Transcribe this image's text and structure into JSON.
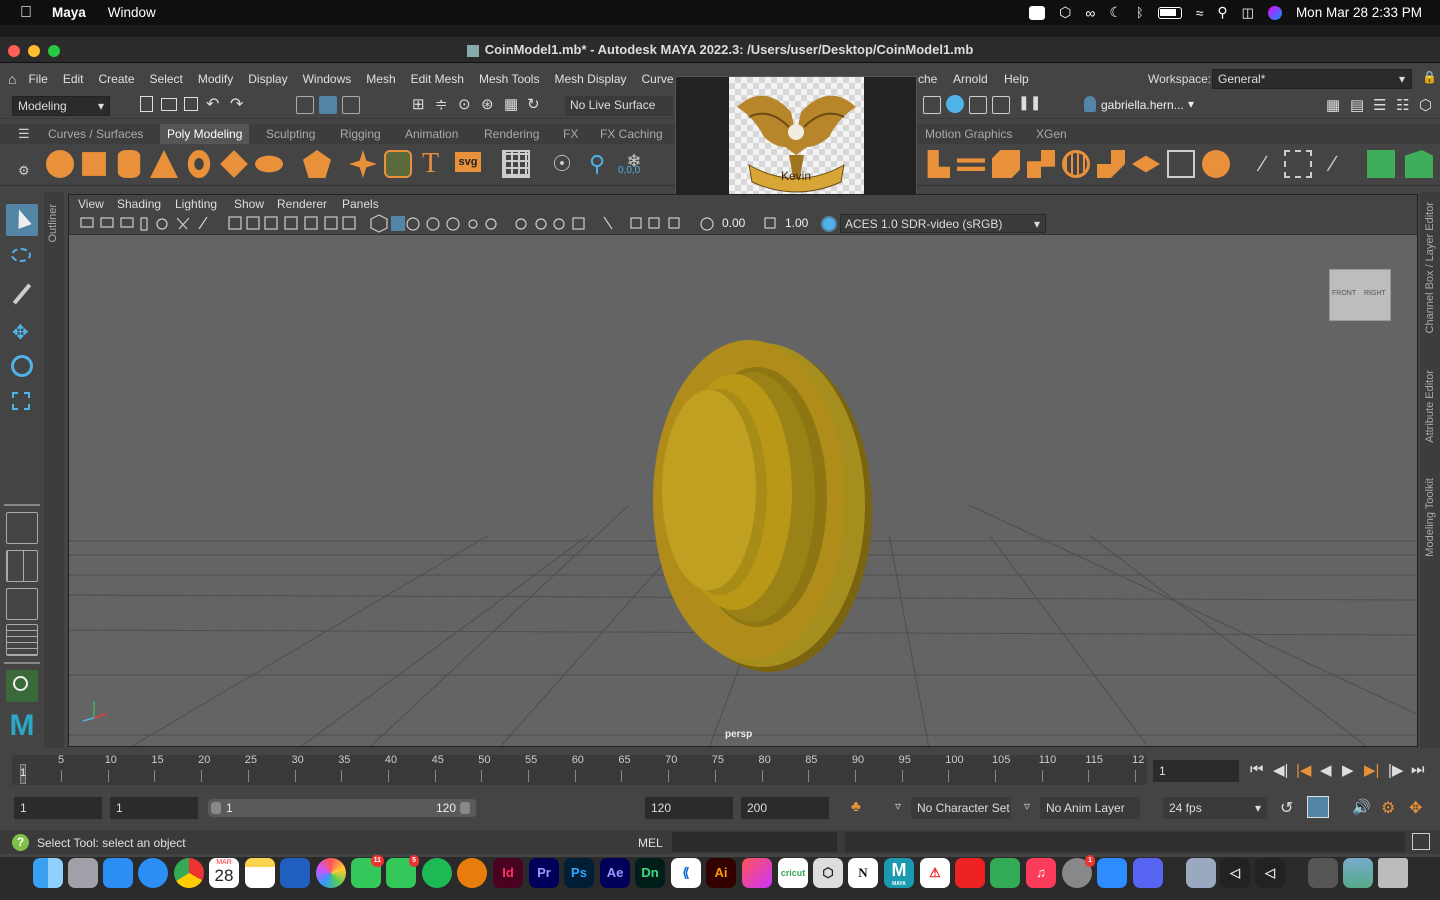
{
  "mac_menubar": {
    "app_name": "Maya",
    "menu_window": "Window",
    "datetime": "Mon Mar 28  2:33 PM"
  },
  "window": {
    "title": "CoinModel1.mb* - Autodesk MAYA 2022.3: /Users/user/Desktop/CoinModel1.mb"
  },
  "menus": [
    "File",
    "Edit",
    "Create",
    "Select",
    "Modify",
    "Display",
    "Windows",
    "Mesh",
    "Edit Mesh",
    "Mesh Tools",
    "Mesh Display",
    "Curve",
    "Arnold",
    "Help"
  ],
  "menu_partial": "che",
  "workspace": {
    "label": "Workspace:",
    "value": "General*"
  },
  "statusline": {
    "mode": "Modeling",
    "live_surface": "No Live Surface",
    "user": "gabriella.hern..."
  },
  "shelf_tabs": [
    "Curves / Surfaces",
    "Poly Modeling",
    "Sculpting",
    "Rigging",
    "Animation",
    "Rendering",
    "FX",
    "FX Caching",
    "Motion Graphics",
    "XGen"
  ],
  "active_shelf": "Poly Modeling",
  "shelf_text_icons": {
    "type": "T",
    "svg": "svg",
    "coords": "0,0,0"
  },
  "popup": {
    "label": "Kevin"
  },
  "viewport": {
    "menus": [
      "View",
      "Shading",
      "Lighting",
      "Show",
      "Renderer",
      "Panels"
    ],
    "exposure": "0.00",
    "gamma": "1.00",
    "colorspace": "ACES 1.0 SDR-video (sRGB)",
    "camera": "persp",
    "viewcube_front": "FRONT",
    "viewcube_right": "RIGHT"
  },
  "side_panels": {
    "left": "Outliner",
    "right": [
      "Channel Box / Layer Editor",
      "Attribute Editor",
      "Modeling Toolkit"
    ]
  },
  "timeline": {
    "ticks": [
      "5",
      "10",
      "15",
      "20",
      "25",
      "30",
      "35",
      "40",
      "45",
      "50",
      "55",
      "60",
      "65",
      "70",
      "75",
      "80",
      "85",
      "90",
      "95",
      "100",
      "105",
      "110",
      "115",
      "12"
    ],
    "start_marker": "1",
    "current_frame": "1"
  },
  "range": {
    "start": "1",
    "playback_start": "1",
    "slider_start": "1",
    "slider_end": "120",
    "playback_end": "120",
    "end": "200",
    "character_set": "No Character Set",
    "anim_layer": "No Anim Layer",
    "fps": "24 fps"
  },
  "helpline": {
    "message": "Select Tool: select an object",
    "mel": "MEL"
  },
  "dock": {
    "calendar_month": "MAR",
    "calendar_day": "28",
    "messages_badge": "11",
    "whatsapp_badge": "5",
    "settings_badge": "1",
    "apps": [
      "Id",
      "Pr",
      "Ps",
      "Ae",
      "Dn",
      "Ai",
      "N"
    ],
    "maya_label": "MAYA",
    "cricut_label": "cricut"
  },
  "colors": {
    "accent_blue": "#5285a6",
    "coin_gold": "#b08d1a",
    "viewport_bg": "#646464",
    "panel_bg": "#444444"
  }
}
